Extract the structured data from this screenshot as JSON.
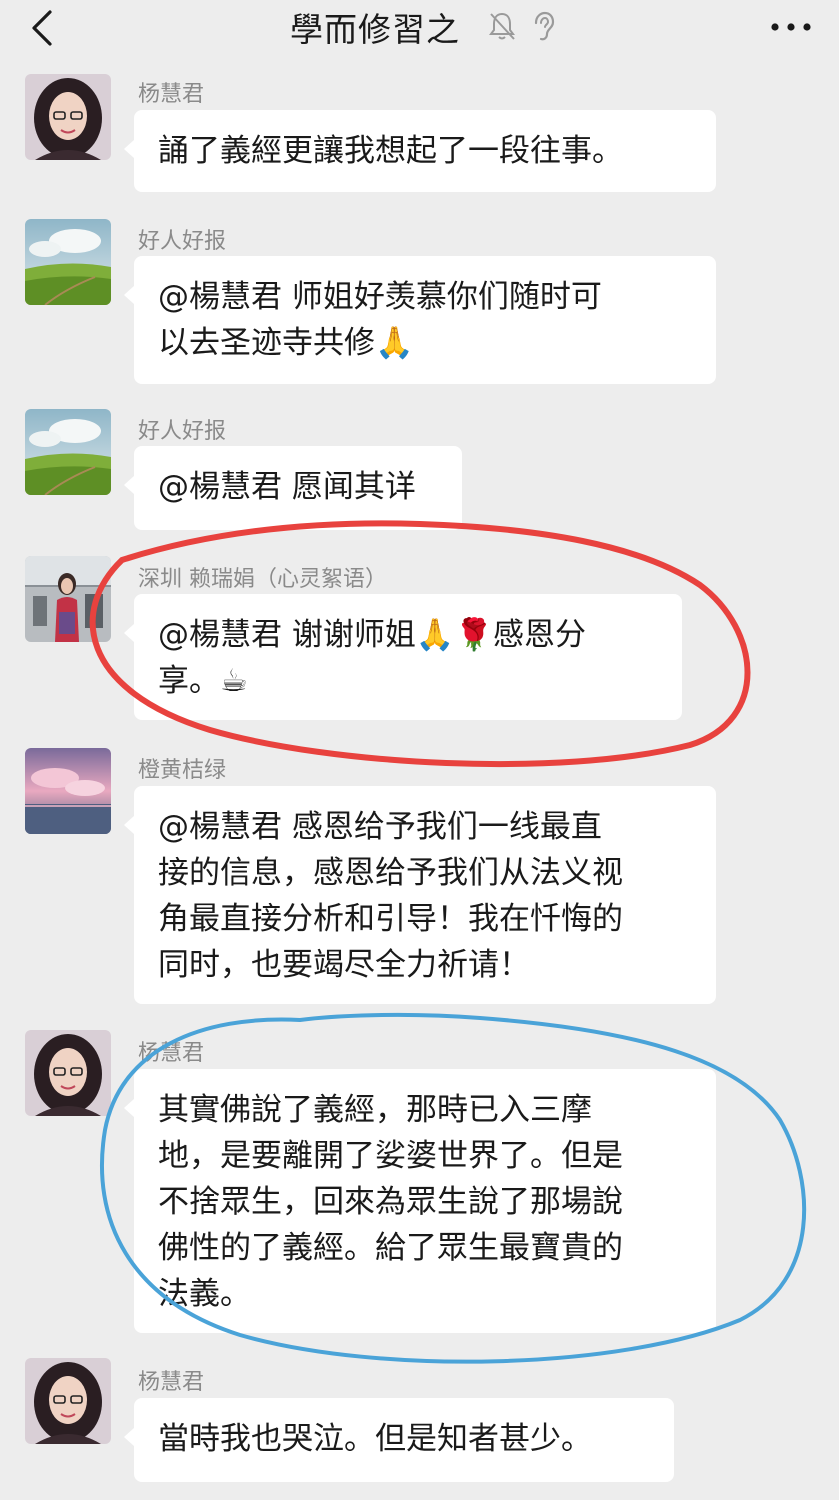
{
  "header": {
    "title": "學而修習之",
    "back_icon": "chevron-left-icon",
    "mute_icon": "bell-off-icon",
    "ear_icon": "ear-icon",
    "more_icon": "more-dots-icon"
  },
  "messages": [
    {
      "sender": "杨慧君",
      "avatar": "woman-glasses-avatar",
      "lines": [
        "誦了義經更讓我想起了一段往事。"
      ]
    },
    {
      "sender": "好人好报",
      "avatar": "landscape-avatar",
      "lines": [
        "@楊慧君  师姐好羡慕你们随时可",
        "以去圣迹寺共修🙏"
      ]
    },
    {
      "sender": "好人好报",
      "avatar": "landscape-avatar",
      "lines": [
        "@楊慧君  愿闻其详"
      ]
    },
    {
      "sender": "深圳 赖瑞娟（心灵絮语）",
      "avatar": "airport-photo-avatar",
      "lines": [
        "@楊慧君  谢谢师姐🙏🌹感恩分",
        "享。☕"
      ]
    },
    {
      "sender": "橙黄桔绿",
      "avatar": "pink-sky-avatar",
      "lines": [
        "@楊慧君  感恩给予我们一线最直",
        "接的信息，感恩给予我们从法义视",
        "角最直接分析和引导！我在忏悔的",
        "同时，也要竭尽全力祈请！"
      ]
    },
    {
      "sender": "杨慧君",
      "avatar": "woman-glasses-avatar",
      "lines": [
        "其實佛說了義經，那時已入三摩",
        "地，是要離開了娑婆世界了。但是",
        "不捨眾生，回來為眾生說了那場說",
        "佛性的了義經。給了眾生最寶貴的",
        "法義。"
      ]
    },
    {
      "sender": "杨慧君",
      "avatar": "woman-glasses-avatar",
      "lines": [
        "當時我也哭泣。但是知者甚少。"
      ]
    }
  ],
  "annotations": {
    "red_circle_color": "#e8423e",
    "blue_circle_color": "#4aa3d8"
  }
}
